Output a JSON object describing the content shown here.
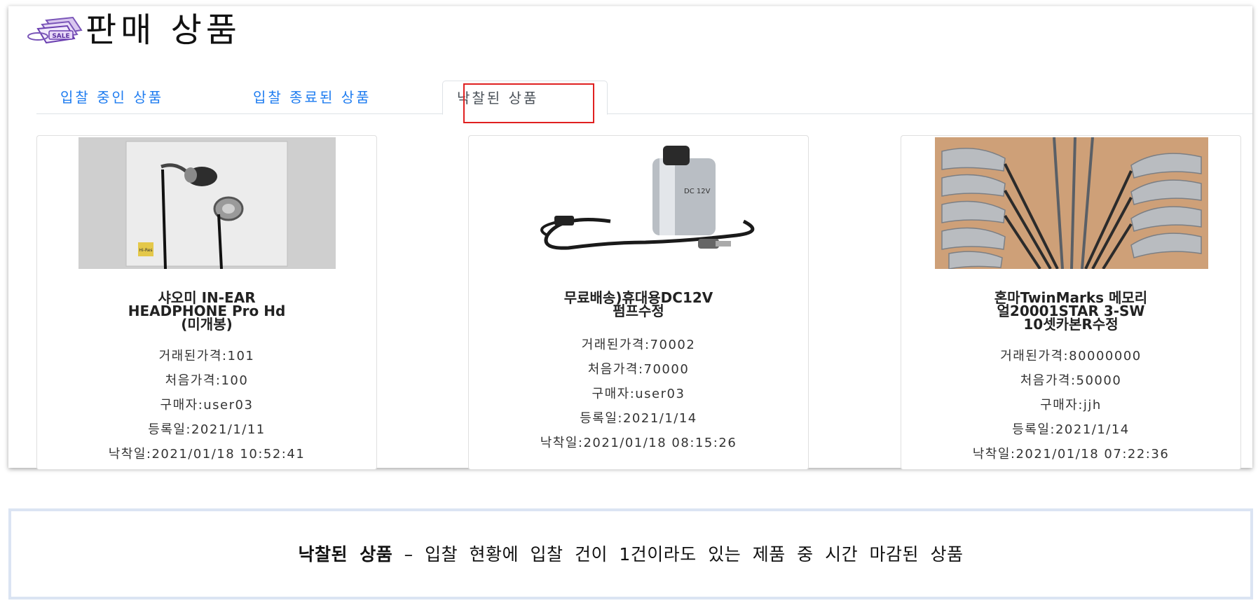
{
  "header": {
    "logo_alt": "SALE",
    "title": "판매 상품"
  },
  "tabs": [
    {
      "label": "입찰 중인 상품",
      "active": false
    },
    {
      "label": "입찰 종료된 상품",
      "active": false
    },
    {
      "label": "낙찰된 상품",
      "active": true
    }
  ],
  "products": [
    {
      "image_icon": "earphone-box-image",
      "title": "샤오미 IN-EAR\nHEADPHONE Pro Hd\n(미개봉)",
      "deal_price": "거래된가격:101",
      "start_price": "처음가격:100",
      "buyer": "구매자:user03",
      "registered": "등록일:2021/1/11",
      "awarded": "낙착일:2021/01/18 10:52:41"
    },
    {
      "image_icon": "dc-pump-image",
      "title": "무료배송)휴대용DC12V\n펌프수정",
      "deal_price": "거래된가격:70002",
      "start_price": "처음가격:70000",
      "buyer": "구매자:user03",
      "registered": "등록일:2021/1/14",
      "awarded": "낙착일:2021/01/18 08:15:26"
    },
    {
      "image_icon": "golf-irons-image",
      "title": "혼마TwinMarks 메모리\n얼20001STAR 3-SW\n10셋카본R수정",
      "deal_price": "거래된가격:80000000",
      "start_price": "처음가격:50000",
      "buyer": "구매자:jjh",
      "registered": "등록일:2021/1/14",
      "awarded": "낙착일:2021/01/18 07:22:36"
    }
  ],
  "caption": {
    "bold": "낙찰된 상품",
    "rest": " – 입찰 현황에 입찰 건이 1건이라도 있는 제품 중 시간 마감된 상품"
  },
  "colors": {
    "tab_link": "#1e7cf0",
    "highlight": "#e02020",
    "caption_border": "#dbe4f3"
  }
}
